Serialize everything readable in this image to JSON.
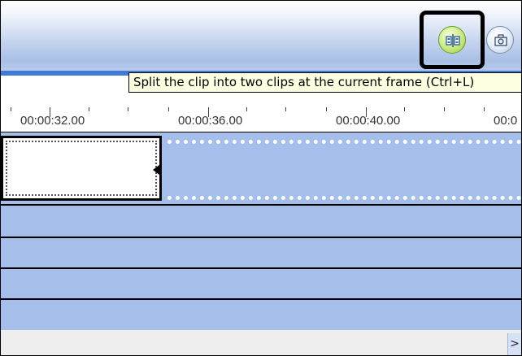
{
  "toolbar": {
    "split_button_icon": "split-clip-icon",
    "snapshot_button_icon": "camera-icon"
  },
  "tooltip": {
    "text": "Split the clip into two clips at the current frame (Ctrl+L)"
  },
  "ruler": {
    "labels": [
      "00:00:32.00",
      "00:00:36.00",
      "00:00:40.00",
      "00:0"
    ]
  },
  "timeline": {
    "selected_clip": "selected-clip",
    "track_color": "#a5bfea"
  },
  "scrollbar": {
    "right_arrow": ">"
  }
}
